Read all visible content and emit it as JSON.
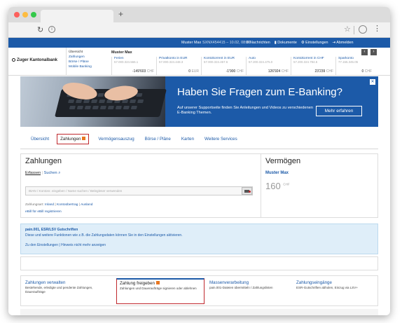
{
  "browser": {
    "new_tab": "+"
  },
  "top": {
    "muster": "Muster Max",
    "user": "SXNX454415 – 10.02, 08:36",
    "links": [
      "Nachrichten",
      "Dokumente",
      "Einstellungen",
      "Abmelden"
    ]
  },
  "bank": {
    "name": "Zuger Kantonalbank"
  },
  "subnav": [
    "Übersicht",
    "Zahlungen",
    "Börse / Pläne",
    "Mobile Banking"
  ],
  "account_owner": "Muster Max",
  "accounts": [
    {
      "name": "Ferien",
      "number": "57.000.324.566.1",
      "balance": "-149'603",
      "currency": "CHF"
    },
    {
      "name": "Privatkonto in EUR",
      "number": "57.000.324.448.3",
      "balance": "0",
      "currency": "EUR"
    },
    {
      "name": "Kontokorrent in EUR",
      "number": "57.000.324.457.6",
      "balance": "-1'900",
      "currency": "CHF"
    },
    {
      "name": "Auto",
      "number": "57.200.324.475.0",
      "balance": "126'924",
      "currency": "CHF"
    },
    {
      "name": "Kontokorrent in CHF",
      "number": "57.200.324.784.5",
      "balance": "23'239",
      "currency": "CHF"
    },
    {
      "name": "Sparkonto",
      "number": "77.155.345.05",
      "balance": "0",
      "currency": "CHF"
    }
  ],
  "banner": {
    "headline": "Haben Sie Fragen zum E-Banking?",
    "text": "Auf unserer Supportseite finden Sie Anleitungen und Videos zu verschiedenen E-Banking Themen.",
    "button": "Mehr erfahren"
  },
  "mainnav": [
    "Übersicht",
    "Zahlungen",
    "Vermögensauszug",
    "Börse / Pläne",
    "Karten",
    "Weitere Services"
  ],
  "zahlungen": {
    "title": "Zahlungen",
    "tab_erfassen": "Erfassen",
    "tab_suchen": "Suchen",
    "search_placeholder": "IBAN / Kontonr. eingeben / Name suchen / Belegleser verwenden",
    "types_label": "Zahlungsart:",
    "types": [
      "Inland",
      "Kontoübertrag",
      "Ausland"
    ],
    "ebill": "eBill für eBill registrieren"
  },
  "vermoegen": {
    "title": "Vermögen",
    "name": "Muster Max",
    "value": "160",
    "currency": "CHF"
  },
  "info": {
    "title": "pain.001, ESR/LSV Gutschriften",
    "text": "Diese und weitere Funktionen wie z.B. die Zahlungsdaten können Sie in den Einstellungen aktivieren.",
    "link1": "Zu den Einstellungen",
    "link2": "Hinweis nicht mehr anzeigen"
  },
  "services": [
    {
      "title": "Zahlungen verwalten",
      "desc": "Bestehende, erledigte und pendente Zahlungen, Daueraufträge"
    },
    {
      "title": "Zahlung freigeben",
      "desc": "Zahlungen und Daueraufträge signieren oder ablehnen"
    },
    {
      "title": "Massenverarbeitung",
      "desc": "pain.001-Dateien übermitteln / Zahlungslisten"
    },
    {
      "title": "Zahlungseingänge",
      "desc": "ESR-Gutschriften abholen, Einzug via LSV+"
    }
  ]
}
